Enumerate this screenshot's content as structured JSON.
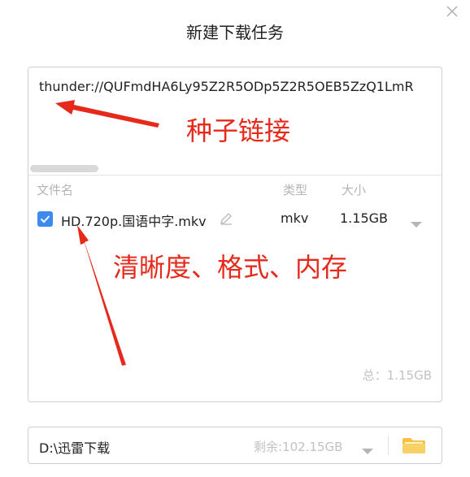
{
  "dialog": {
    "title": "新建下载任务",
    "close_icon": "close-icon"
  },
  "link": {
    "value": "thunder://QUFmdHA6Ly95Z2R5ODp5Z2R5OEB5ZzQ1LmR"
  },
  "file_list": {
    "headers": {
      "name": "文件名",
      "type": "类型",
      "size": "大小"
    },
    "items": [
      {
        "checked": true,
        "name": "HD.720p.国语中字.mkv",
        "type": "mkv",
        "size": "1.15GB"
      }
    ],
    "total": "总：1.15GB"
  },
  "annotations": {
    "torrent_link": "种子链接",
    "file_info": "清晰度、格式、内存",
    "color": "#e52a1c"
  },
  "save_path": {
    "value": "D:\\迅雷下载",
    "free_space": "剩余:102.15GB",
    "folder_icon": "folder-icon"
  },
  "colors": {
    "accent": "#3d8bf2",
    "folder": "#f5c243",
    "muted": "#b5b5b5"
  }
}
